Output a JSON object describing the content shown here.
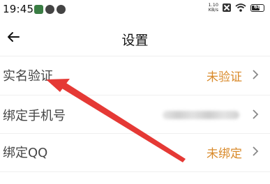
{
  "status_bar": {
    "time": "19:45",
    "net_speed_value": "1.10",
    "net_speed_unit": "KB/s",
    "battery_level": "68",
    "battery_fraction": 0.68
  },
  "header": {
    "title": "设置"
  },
  "settings": {
    "items": [
      {
        "label": "实名验证",
        "value": "未验证"
      },
      {
        "label": "绑定手机号",
        "value": ""
      },
      {
        "label": "绑定QQ",
        "value": "未绑定"
      }
    ]
  },
  "colors": {
    "accent": "#d98a2b",
    "annotation_arrow": "#e53935"
  }
}
